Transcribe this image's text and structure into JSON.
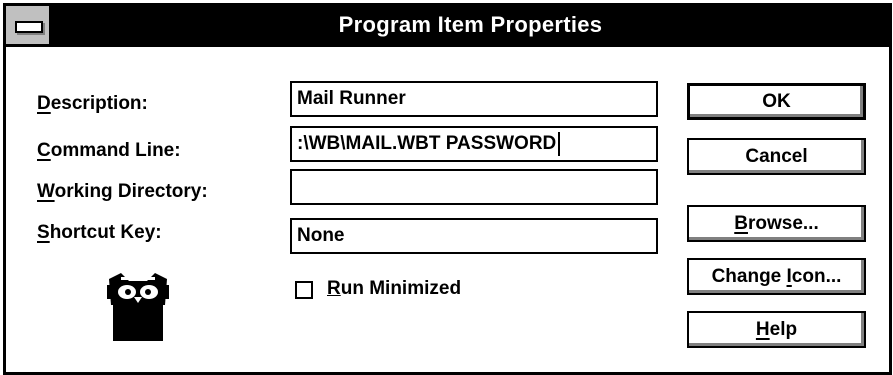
{
  "window": {
    "title": "Program Item Properties",
    "system_menu_icon": "system-menu-dash-icon"
  },
  "labels": {
    "description": {
      "mnemonic": "D",
      "rest": "escription:"
    },
    "command_line": {
      "mnemonic": "C",
      "rest": "ommand Line:"
    },
    "working_directory": {
      "mnemonic": "W",
      "rest": "orking Directory:"
    },
    "shortcut_key": {
      "mnemonic": "S",
      "rest": "hortcut Key:"
    }
  },
  "fields": {
    "description": "Mail Runner",
    "command_line": ":\\WB\\MAIL.WBT PASSWORD",
    "working_directory": "",
    "shortcut_key": "None"
  },
  "checkbox": {
    "run_minimized": {
      "mnemonic": "R",
      "rest": "un Minimized",
      "checked": false
    }
  },
  "buttons": {
    "ok": "OK",
    "cancel": "Cancel",
    "browse": {
      "mnemonic": "B",
      "rest": "rowse..."
    },
    "change_icon": {
      "before": "Change ",
      "mnemonic": "I",
      "rest": "con..."
    },
    "help": {
      "mnemonic": "H",
      "rest": "elp"
    }
  },
  "program_icon": "owl-icon"
}
